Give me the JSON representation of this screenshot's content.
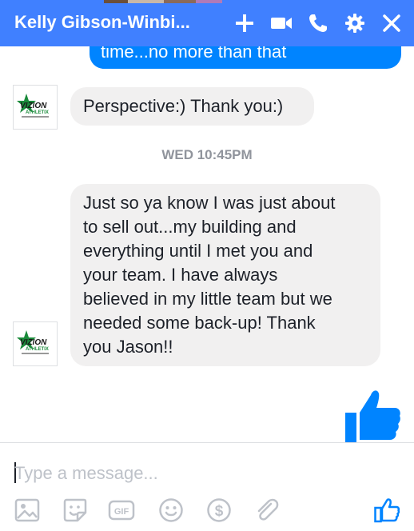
{
  "header": {
    "title": "Kelly Gibson-Winbi...",
    "background_color": "#4080ff",
    "icons": [
      "add-person-icon",
      "video-call-icon",
      "phone-call-icon",
      "gear-icon",
      "close-icon"
    ]
  },
  "messages": {
    "outgoing_partial": {
      "text": "time...no more than that",
      "color": "#0084ff"
    },
    "incoming_1": {
      "text": "Perspective:) Thank you:)"
    },
    "timestamp": "WED 10:45PM",
    "incoming_2": {
      "lines": [
        "Just so ya know I was just about",
        "to sell out...my building and",
        "everything until I met you and",
        "your team. I have always",
        "believed in my little team but we",
        "needed some back-up! Thank",
        "you Jason!!"
      ]
    },
    "sent_sticker": "thumbs-up-icon"
  },
  "avatar": {
    "logo_text": "VIZION",
    "logo_subtext": "ATHLETIX"
  },
  "composer": {
    "placeholder": "Type a message...",
    "value": "",
    "toolbar_icons": [
      "image-icon",
      "sticker-icon",
      "gif-icon",
      "emoji-icon",
      "payment-icon",
      "attachment-icon",
      "like-icon"
    ],
    "gif_label": "GIF",
    "payment_symbol": "$",
    "icon_color": "#bec2c9",
    "like_color": "#0084ff"
  }
}
